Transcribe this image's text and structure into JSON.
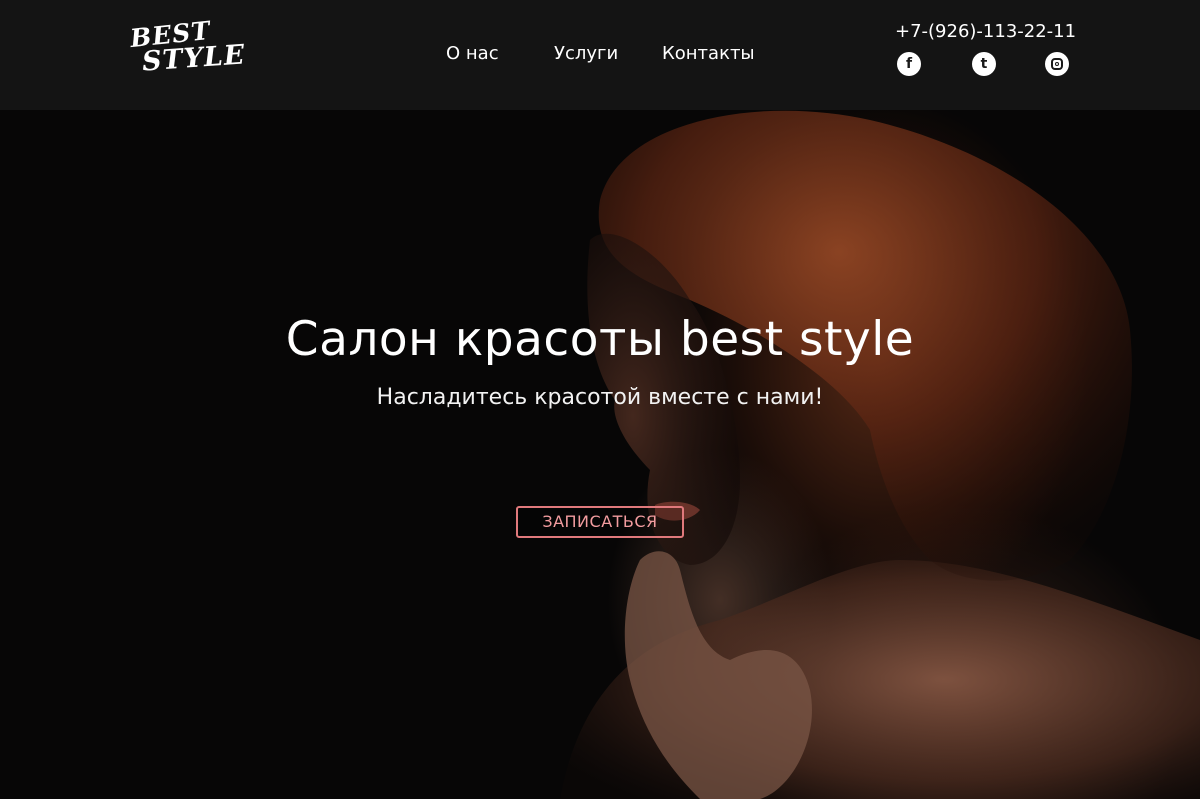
{
  "brand": {
    "logo_line1": "BEST",
    "logo_line2": "STYLE"
  },
  "nav": {
    "items": [
      {
        "label": "О нас"
      },
      {
        "label": "Услуги"
      },
      {
        "label": "Контакты"
      }
    ]
  },
  "contacts": {
    "phone": "+7-(926)-113-22-11",
    "social": [
      {
        "icon": "facebook-icon",
        "glyph": "f"
      },
      {
        "icon": "tumblr-icon",
        "glyph": "t"
      },
      {
        "icon": "instagram-icon",
        "glyph": ""
      }
    ]
  },
  "hero": {
    "title": "Салон красоты best style",
    "subtitle": "Насладитесь красотой вместе с нами!",
    "cta_label": "ЗАПИСАТЬСЯ"
  },
  "colors": {
    "header_bg": "#161616",
    "page_bg": "#070606",
    "cta_border": "#e0797c",
    "cta_text": "#f29c9f",
    "text": "#ffffff"
  }
}
